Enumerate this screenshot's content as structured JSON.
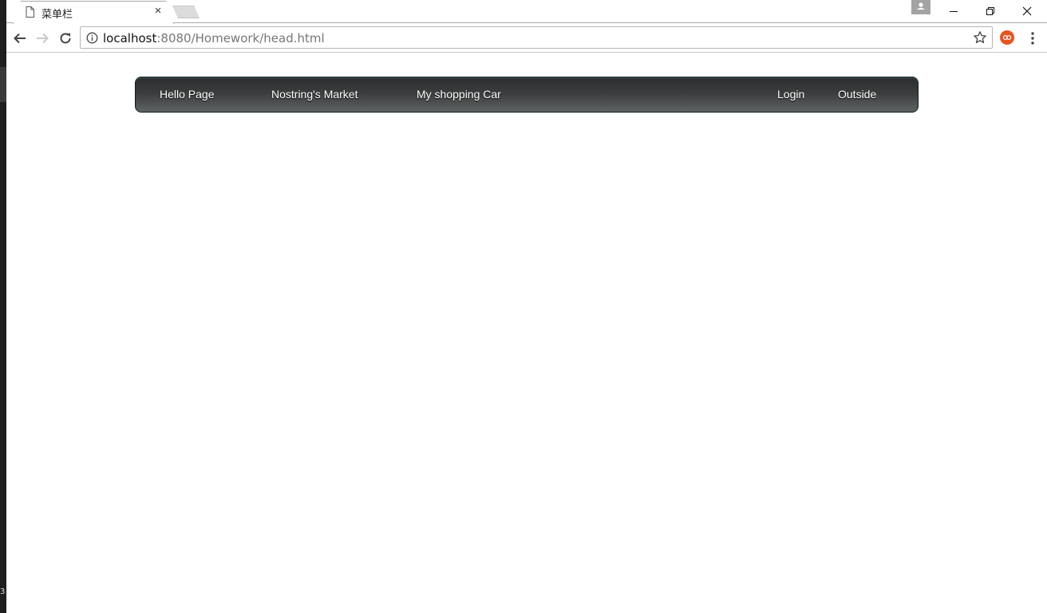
{
  "browser": {
    "tab": {
      "title": "菜单栏",
      "icon": "page-icon",
      "close_glyph": "×"
    },
    "address": {
      "host": "localhost",
      "rest": ":8080/Homework/head.html"
    },
    "icons": {
      "back": "arrow-left-icon",
      "forward": "arrow-right-icon",
      "reload": "reload-icon",
      "info": "info-icon",
      "bookmark": "star-icon",
      "extension": "extension-icon",
      "menu": "kebab-menu-icon",
      "profile": "profile-icon",
      "minimize": "minimize-icon",
      "restore": "restore-icon",
      "close": "close-icon"
    },
    "colors": {
      "extension_accent": "#e8541f",
      "navbar_dark": "#2b2d2e",
      "navbar_light": "#5f6262"
    }
  },
  "desktop": {
    "edge_digit": "3"
  },
  "navbar": {
    "items": [
      {
        "label": "Hello Page"
      },
      {
        "label": "Nostring's Market"
      },
      {
        "label": "My shopping Car"
      },
      {
        "label": "Login"
      },
      {
        "label": "Outside"
      }
    ]
  }
}
